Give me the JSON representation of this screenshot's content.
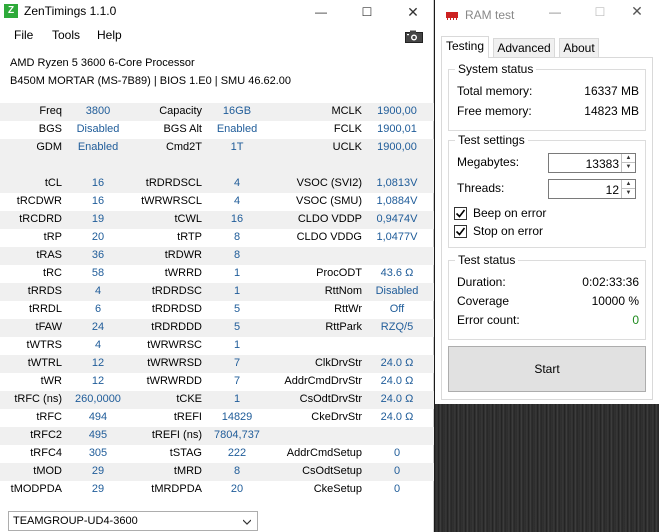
{
  "zentimings": {
    "title": "ZenTimings 1.1.0",
    "logo_letter": "Z",
    "menu": [
      "File",
      "Tools",
      "Help"
    ],
    "cpu": "AMD Ryzen 5 3600 6-Core Processor",
    "board": "B450M MORTAR (MS-7B89) | BIOS 1.E0 | SMU 46.62.00",
    "rows": [
      [
        "Freq",
        "3800",
        "Capacity",
        "16GB",
        "MCLK",
        "1900,00"
      ],
      [
        "BGS",
        "Disabled",
        "BGS Alt",
        "Enabled",
        "FCLK",
        "1900,01"
      ],
      [
        "GDM",
        "Enabled",
        "Cmd2T",
        "1T",
        "UCLK",
        "1900,00"
      ],
      [
        "",
        "",
        "",
        "",
        "",
        ""
      ],
      [
        "tCL",
        "16",
        "tRDRDSCL",
        "4",
        "VSOC (SVI2)",
        "1,0813V"
      ],
      [
        "tRCDWR",
        "16",
        "tWRWRSCL",
        "4",
        "VSOC (SMU)",
        "1,0884V"
      ],
      [
        "tRCDRD",
        "19",
        "tCWL",
        "16",
        "CLDO VDDP",
        "0,9474V"
      ],
      [
        "tRP",
        "20",
        "tRTP",
        "8",
        "CLDO VDDG",
        "1,0477V"
      ],
      [
        "tRAS",
        "36",
        "tRDWR",
        "8",
        "",
        ""
      ],
      [
        "tRC",
        "58",
        "tWRRD",
        "1",
        "ProcODT",
        "43.6 Ω"
      ],
      [
        "tRRDS",
        "4",
        "tRDRDSC",
        "1",
        "RttNom",
        "Disabled"
      ],
      [
        "tRRDL",
        "6",
        "tRDRDSD",
        "5",
        "RttWr",
        "Off"
      ],
      [
        "tFAW",
        "24",
        "tRDRDDD",
        "5",
        "RttPark",
        "RZQ/5"
      ],
      [
        "tWTRS",
        "4",
        "tWRWRSC",
        "1",
        "",
        ""
      ],
      [
        "tWTRL",
        "12",
        "tWRWRSD",
        "7",
        "ClkDrvStr",
        "24.0 Ω"
      ],
      [
        "tWR",
        "12",
        "tWRWRDD",
        "7",
        "AddrCmdDrvStr",
        "24.0 Ω"
      ],
      [
        "tRFC (ns)",
        "260,0000",
        "tCKE",
        "1",
        "CsOdtDrvStr",
        "24.0 Ω"
      ],
      [
        "tRFC",
        "494",
        "tREFI",
        "14829",
        "CkeDrvStr",
        "24.0 Ω"
      ],
      [
        "tRFC2",
        "495",
        "tREFI (ns)",
        "7804,737",
        "",
        ""
      ],
      [
        "tRFC4",
        "305",
        "tSTAG",
        "222",
        "AddrCmdSetup",
        "0"
      ],
      [
        "tMOD",
        "29",
        "tMRD",
        "8",
        "CsOdtSetup",
        "0"
      ],
      [
        "tMODPDA",
        "29",
        "tMRDPDA",
        "20",
        "CkeSetup",
        "0"
      ]
    ],
    "module": "TEAMGROUP-UD4-3600"
  },
  "ramtest": {
    "title": "RAM test",
    "tabs": [
      "Testing",
      "Advanced",
      "About"
    ],
    "system_status": {
      "title": "System status",
      "total_label": "Total memory:",
      "total_value": "16337 MB",
      "free_label": "Free memory:",
      "free_value": "14823 MB"
    },
    "settings": {
      "title": "Test settings",
      "megabytes_label": "Megabytes:",
      "megabytes_value": "13383",
      "threads_label": "Threads:",
      "threads_value": "12",
      "beep_label": "Beep on error",
      "beep_checked": true,
      "stop_label": "Stop on error",
      "stop_checked": true
    },
    "test_status": {
      "title": "Test status",
      "duration_label": "Duration:",
      "duration_value": "0:02:33:36",
      "coverage_label": "Coverage",
      "coverage_value": "10000 %",
      "errors_label": "Error count:",
      "errors_value": "0"
    },
    "start_label": "Start"
  },
  "colors": {
    "value_blue": "#1f5c99",
    "row_shade": "#f0f0f0",
    "logo_green": "#2eaa3a",
    "ok_green": "#1e8b1e"
  }
}
